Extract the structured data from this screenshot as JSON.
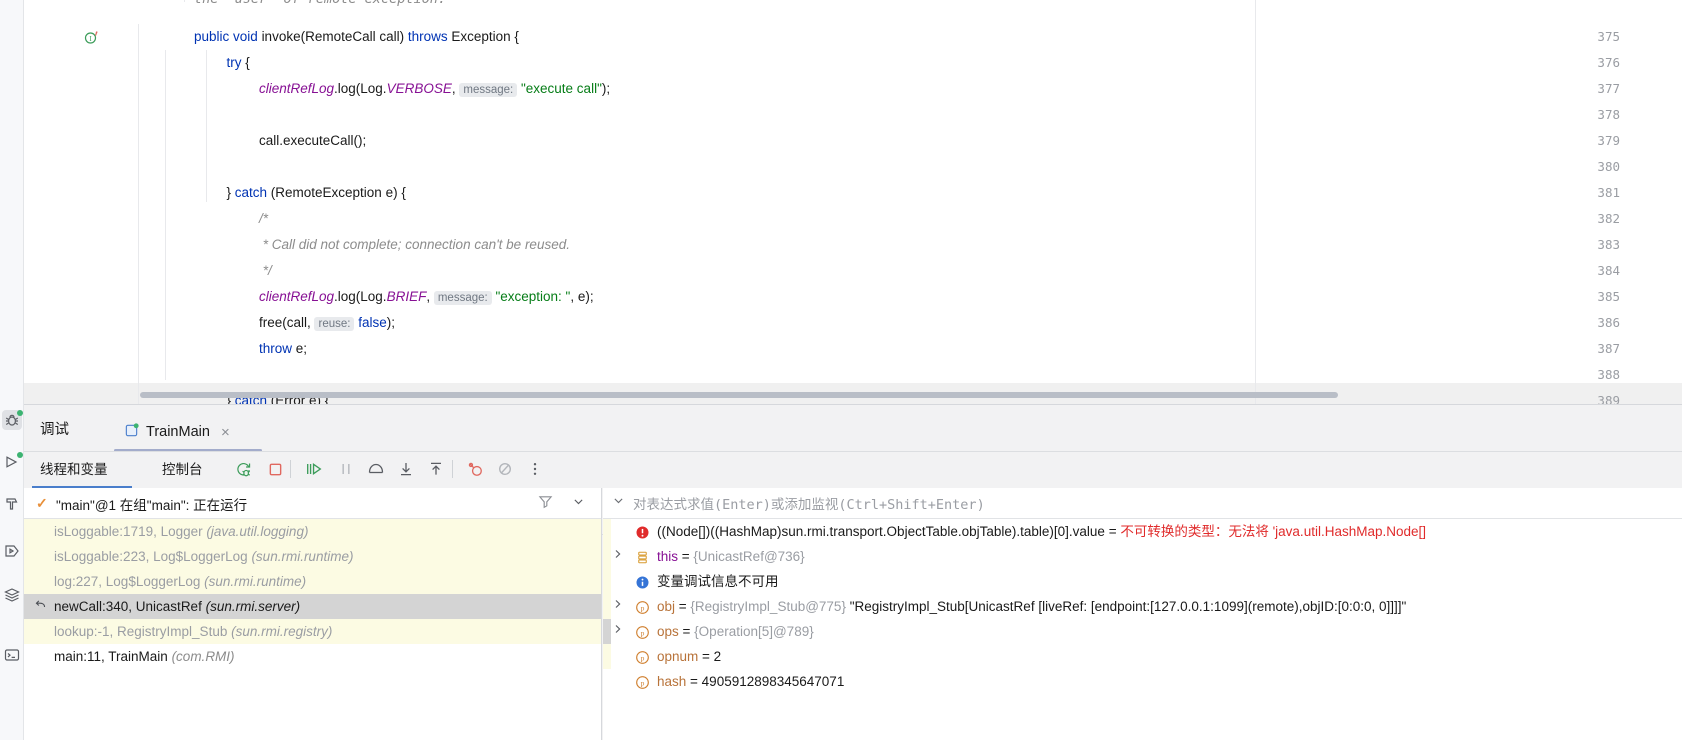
{
  "editor": {
    "partial_top_comment": "the \"user\" of remote exception.",
    "lines": [
      {
        "num": "375",
        "marker": "override-method-icon",
        "indent": 0,
        "segments": [
          {
            "t": "public ",
            "c": "k"
          },
          {
            "t": "void ",
            "c": "k"
          },
          {
            "t": "invoke(RemoteCall call) ",
            "c": ""
          },
          {
            "t": "throws ",
            "c": "k"
          },
          {
            "t": "Exception {",
            "c": ""
          }
        ]
      },
      {
        "num": "376",
        "marker": "",
        "indent": 1,
        "segments": [
          {
            "t": "try",
            "c": "k"
          },
          {
            "t": " {",
            "c": ""
          }
        ]
      },
      {
        "num": "377",
        "marker": "",
        "indent": 2,
        "segments": [
          {
            "t": "clientRefLog",
            "c": "fld"
          },
          {
            "t": ".log(Log.",
            "c": ""
          },
          {
            "t": "VERBOSE",
            "c": "cst"
          },
          {
            "t": ", ",
            "c": ""
          },
          {
            "t": "message:",
            "c": "hint"
          },
          {
            "t": " ",
            "c": ""
          },
          {
            "t": "\"execute call\"",
            "c": "str"
          },
          {
            "t": ");",
            "c": ""
          }
        ]
      },
      {
        "num": "378",
        "marker": "",
        "indent": 0,
        "segments": []
      },
      {
        "num": "379",
        "marker": "",
        "indent": 2,
        "segments": [
          {
            "t": "call.executeCall();",
            "c": ""
          }
        ]
      },
      {
        "num": "380",
        "marker": "",
        "indent": 0,
        "segments": []
      },
      {
        "num": "381",
        "marker": "",
        "indent": 1,
        "segments": [
          {
            "t": "} ",
            "c": ""
          },
          {
            "t": "catch ",
            "c": "k"
          },
          {
            "t": "(RemoteException e) {",
            "c": ""
          }
        ]
      },
      {
        "num": "382",
        "marker": "",
        "indent": 2,
        "segments": [
          {
            "t": "/*",
            "c": "cmt"
          }
        ]
      },
      {
        "num": "383",
        "marker": "",
        "indent": 2,
        "segments": [
          {
            "t": " * Call did not complete; connection can't be reused.",
            "c": "cmt"
          }
        ]
      },
      {
        "num": "384",
        "marker": "",
        "indent": 2,
        "segments": [
          {
            "t": " */",
            "c": "cmt"
          }
        ]
      },
      {
        "num": "385",
        "marker": "",
        "indent": 2,
        "segments": [
          {
            "t": "clientRefLog",
            "c": "fld"
          },
          {
            "t": ".log(Log.",
            "c": ""
          },
          {
            "t": "BRIEF",
            "c": "cst"
          },
          {
            "t": ", ",
            "c": ""
          },
          {
            "t": "message:",
            "c": "hint"
          },
          {
            "t": " ",
            "c": ""
          },
          {
            "t": "\"exception: \"",
            "c": "str"
          },
          {
            "t": ", e);",
            "c": ""
          }
        ]
      },
      {
        "num": "386",
        "marker": "",
        "indent": 2,
        "segments": [
          {
            "t": "free(call, ",
            "c": ""
          },
          {
            "t": "reuse:",
            "c": "hint"
          },
          {
            "t": " ",
            "c": ""
          },
          {
            "t": "false",
            "c": "k"
          },
          {
            "t": ");",
            "c": ""
          }
        ]
      },
      {
        "num": "387",
        "marker": "",
        "indent": 2,
        "segments": [
          {
            "t": "throw",
            "c": "k"
          },
          {
            "t": " e;",
            "c": ""
          }
        ]
      },
      {
        "num": "388",
        "marker": "",
        "indent": 0,
        "segments": []
      },
      {
        "num": "389",
        "marker": "",
        "indent": 1,
        "segments": [
          {
            "t": "} ",
            "c": ""
          },
          {
            "t": "catch ",
            "c": "k"
          },
          {
            "t": "(Error e) {",
            "c": ""
          }
        ]
      }
    ]
  },
  "debug_window": {
    "title": "调试",
    "run_tab": {
      "label": "TrainMain",
      "icon": "run-configuration-icon",
      "close": "×"
    },
    "toolbar": {
      "tabs": [
        {
          "label": "线程和变量",
          "selected": true
        },
        {
          "label": "控制台",
          "selected": false
        }
      ],
      "buttons": [
        {
          "name": "rerun-debug-button",
          "glyph": "rerun-icon"
        },
        {
          "name": "stop-button",
          "glyph": "stop-icon"
        },
        {
          "name": "resume-program-button",
          "glyph": "resume-icon"
        },
        {
          "name": "pause-program-button",
          "glyph": "pause-icon"
        },
        {
          "name": "step-over-button",
          "glyph": "step-over-icon"
        },
        {
          "name": "step-into-button",
          "glyph": "step-into-icon"
        },
        {
          "name": "step-out-button",
          "glyph": "step-out-icon"
        },
        {
          "name": "view-breakpoints-button",
          "glyph": "breakpoint-icon"
        },
        {
          "name": "mute-breakpoints-button",
          "glyph": "mute-breakpoint-icon"
        },
        {
          "name": "more-options-button",
          "glyph": "more-vertical-icon"
        }
      ]
    },
    "threads": {
      "header": "\"main\"@1 在组\"main\": 正在运行",
      "frames": [
        {
          "name": "isLoggable:1719, Logger",
          "pkg": "(java.util.logging)",
          "kind": "lib",
          "selected": false
        },
        {
          "name": "isLoggable:223, Log$LoggerLog",
          "pkg": "(sun.rmi.runtime)",
          "kind": "lib",
          "selected": false
        },
        {
          "name": "log:227, Log$LoggerLog",
          "pkg": "(sun.rmi.runtime)",
          "kind": "lib",
          "selected": false
        },
        {
          "name": "newCall:340, UnicastRef",
          "pkg": "(sun.rmi.server)",
          "kind": "sel",
          "selected": true
        },
        {
          "name": "lookup:-1, RegistryImpl_Stub",
          "pkg": "(sun.rmi.registry)",
          "kind": "lib",
          "selected": false
        },
        {
          "name": "main:11, TrainMain",
          "pkg": "(com.RMI)",
          "kind": "usr",
          "selected": false
        }
      ]
    },
    "variables": {
      "watch_placeholder": "对表达式求值(Enter)或添加监视(Ctrl+Shift+Enter)",
      "rows": [
        {
          "kind": "error",
          "icon": "error-icon",
          "toggle": "",
          "expr": "((Node[])((HashMap)sun.rmi.transport.ObjectTable.objTable).table)[0].value",
          "eq": " = ",
          "error_text": "不可转换的类型：无法将 'java.util.HashMap.Node[]"
        },
        {
          "kind": "object",
          "icon": "this-icon",
          "toggle": "›",
          "name": "this",
          "eq": " = ",
          "type": "{UnicastRef@736}",
          "value": ""
        },
        {
          "kind": "info",
          "icon": "info-icon",
          "toggle": "",
          "text": "变量调试信息不可用"
        },
        {
          "kind": "field",
          "icon": "param-icon",
          "toggle": "›",
          "name": "obj",
          "eq": " = ",
          "type": "{RegistryImpl_Stub@775}",
          "value": "\"RegistryImpl_Stub[UnicastRef [liveRef: [endpoint:[127.0.0.1:1099](remote),objID:[0:0:0, 0]]]]\""
        },
        {
          "kind": "field",
          "icon": "param-icon",
          "toggle": "›",
          "name": "ops",
          "eq": " = ",
          "type": "{Operation[5]@789}",
          "value": ""
        },
        {
          "kind": "field",
          "icon": "param-icon",
          "toggle": "",
          "name": "opnum",
          "eq": " = ",
          "type": "",
          "value": "2"
        },
        {
          "kind": "field",
          "icon": "param-icon",
          "toggle": "",
          "name": "hash",
          "eq": " = ",
          "type": "",
          "value": "4905912898345647071"
        }
      ]
    }
  },
  "rail": {
    "items": [
      {
        "name": "rail-item-debug",
        "icon": "bug-icon",
        "selected": true,
        "badge": true
      },
      {
        "name": "rail-item-run",
        "icon": "run-icon",
        "selected": false,
        "badge": true
      },
      {
        "name": "rail-item-build",
        "icon": "hammer-icon",
        "selected": false,
        "badge": false
      },
      {
        "name": "rail-item-services",
        "icon": "services-icon",
        "selected": false,
        "badge": false
      },
      {
        "name": "rail-item-structure",
        "icon": "layers-icon",
        "selected": false,
        "badge": false
      },
      {
        "name": "rail-item-terminal",
        "icon": "terminal-icon",
        "selected": false,
        "badge": false
      }
    ]
  },
  "colors": {
    "keyword": "#0033b3",
    "string": "#067d17",
    "field": "#871094",
    "comment": "#8c8c8c",
    "error": "#e02b2b",
    "selection": "#d4d4d4",
    "library_frame_bg": "#fcfbe3",
    "accent": "#4a7ecb"
  }
}
